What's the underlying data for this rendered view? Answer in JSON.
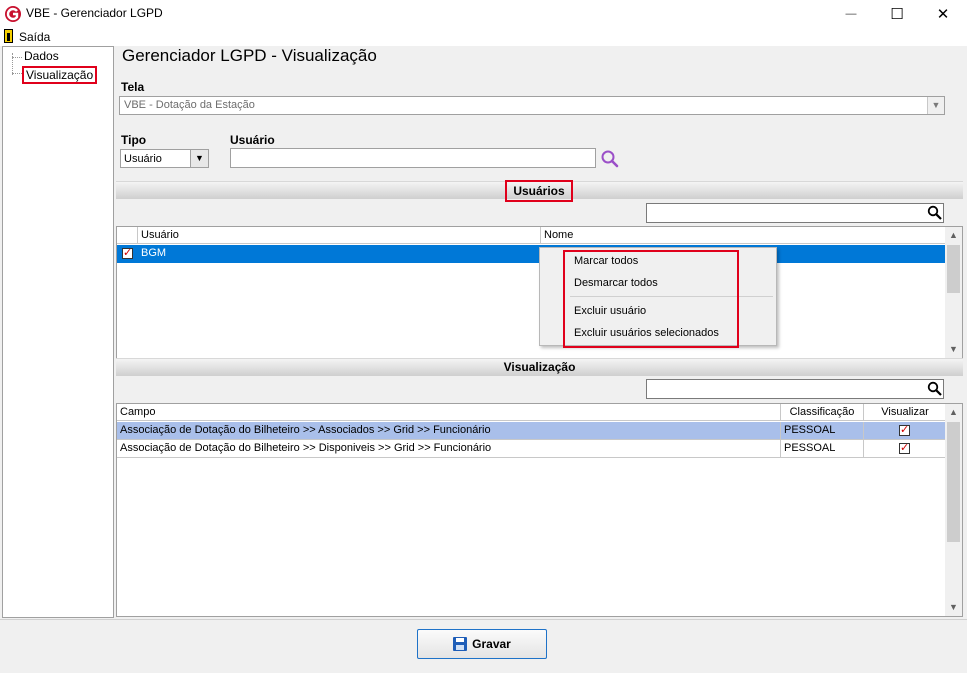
{
  "window": {
    "title": "VBE - Gerenciador LGPD",
    "minimize": "—",
    "maximize": "☐",
    "close": "✕"
  },
  "menu": {
    "exit_label": "Saída"
  },
  "tree": {
    "items": [
      {
        "label": "Dados"
      },
      {
        "label": "Visualização",
        "selected": true
      }
    ]
  },
  "page": {
    "heading": "Gerenciador LGPD - Visualização"
  },
  "tela": {
    "label": "Tela",
    "value": "VBE - Dotação da Estação"
  },
  "tipo": {
    "label": "Tipo",
    "value": "Usuário"
  },
  "usuario": {
    "label": "Usuário",
    "value": ""
  },
  "users_section": {
    "title": "Usuários",
    "filter_value": "",
    "columns": [
      "Usuário",
      "Nome"
    ],
    "rows": [
      {
        "checked": true,
        "usuario": "BGM",
        "nome": ""
      }
    ]
  },
  "context_menu": {
    "items": [
      "Marcar todos",
      "Desmarcar todos",
      "Excluir usuário",
      "Excluir usuários selecionados"
    ]
  },
  "vis_section": {
    "title": "Visualização",
    "filter_value": "",
    "columns": [
      "Campo",
      "Classificação",
      "Visualizar"
    ],
    "rows": [
      {
        "campo": "Associação de Dotação do Bilheteiro >> Associados >> Grid >> Funcionário",
        "classificacao": "PESSOAL",
        "visualizar": true
      },
      {
        "campo": "Associação de Dotação do Bilheteiro >> Disponiveis >> Grid >> Funcionário",
        "classificacao": "PESSOAL",
        "visualizar": true
      }
    ]
  },
  "save_button": {
    "label": "Gravar"
  },
  "colors": {
    "selection_blue": "#0078d7",
    "selection_light": "#a9bfea",
    "highlight_red": "#e0001b",
    "brand_red": "#c8102e"
  },
  "icons": {
    "app": "app-logo-icon",
    "exit": "exit-door-icon",
    "search": "search-icon",
    "filter": "magnifier-icon",
    "save": "floppy-disk-icon"
  }
}
